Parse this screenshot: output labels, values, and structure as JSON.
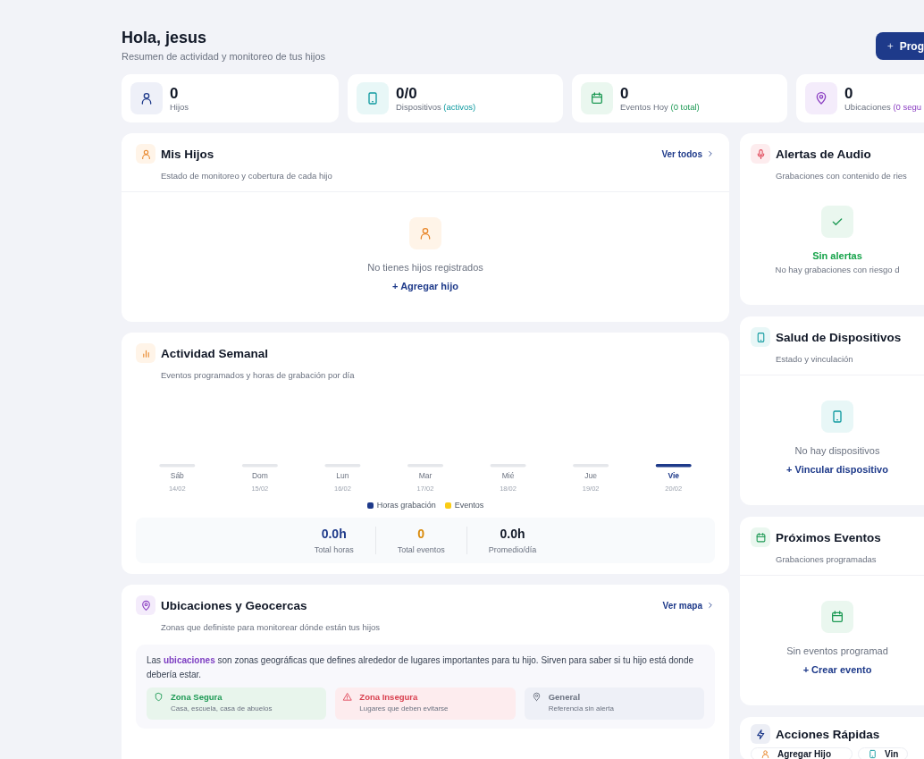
{
  "header": {
    "title": "Hola, jesus",
    "subtitle": "Resumen de actividad y monitoreo de tus hijos",
    "action_button": "Prog"
  },
  "stats": [
    {
      "kind": "children",
      "value": "0",
      "label": "Hijos"
    },
    {
      "kind": "devices",
      "value": "0/0",
      "label": "Dispositivos",
      "note": "(activos)"
    },
    {
      "kind": "events",
      "value": "0",
      "label": "Eventos Hoy",
      "note": "(0 total)"
    },
    {
      "kind": "locations",
      "value": "0",
      "label": "Ubicaciones",
      "note": "(0 segu"
    }
  ],
  "children_card": {
    "title": "Mis Hijos",
    "subtitle": "Estado de monitoreo y cobertura de cada hijo",
    "link": "Ver todos",
    "empty_message": "No tienes hijos registrados",
    "empty_action": "+ Agregar hijo"
  },
  "activity_card": {
    "title": "Actividad Semanal",
    "subtitle": "Eventos programados y horas de grabación por día",
    "days": [
      {
        "label": "Sáb",
        "date": "14/02",
        "selected": false
      },
      {
        "label": "Dom",
        "date": "15/02",
        "selected": false
      },
      {
        "label": "Lun",
        "date": "16/02",
        "selected": false
      },
      {
        "label": "Mar",
        "date": "17/02",
        "selected": false
      },
      {
        "label": "Mié",
        "date": "18/02",
        "selected": false
      },
      {
        "label": "Jue",
        "date": "19/02",
        "selected": false
      },
      {
        "label": "Vie",
        "date": "20/02",
        "selected": true
      }
    ],
    "legend": [
      {
        "label": "Horas grabación",
        "color": "#1e3a8a"
      },
      {
        "label": "Eventos",
        "color": "#facc15"
      }
    ],
    "totals": [
      {
        "value": "0.0h",
        "label": "Total horas",
        "color": "#1e3a8a"
      },
      {
        "value": "0",
        "label": "Total eventos",
        "color": "#d98a0b"
      },
      {
        "value": "0.0h",
        "label": "Promedio/día",
        "color": "#111827"
      }
    ]
  },
  "locations_card": {
    "title": "Ubicaciones y Geocercas",
    "subtitle": "Zonas que definiste para monitorear dónde están tus hijos",
    "link": "Ver mapa",
    "info": "Las **ubicaciones** son zonas geográficas que defines alrededor de lugares importantes para tu hijo. Sirven para saber si tu hijo está donde debería estar.",
    "zones": [
      {
        "kind": "safe",
        "title": "Zona Segura",
        "description": "Casa, escuela, casa de abuelos"
      },
      {
        "kind": "unsafe",
        "title": "Zona Insegura",
        "description": "Lugares que deben evitarse"
      },
      {
        "kind": "general",
        "title": "General",
        "description": "Referencia sin alerta"
      }
    ]
  },
  "sidebar": [
    {
      "kind": "audio",
      "title": "Alertas de Audio",
      "subtitle": "Grabaciones con contenido de ries",
      "empty_status": "Sin alertas",
      "empty_message": "No hay grabaciones con riesgo d"
    },
    {
      "kind": "devices",
      "title": "Salud de Dispositivos",
      "subtitle": "Estado y vinculación",
      "empty_message": "No hay dispositivos",
      "empty_action": "+ Vincular dispositivo"
    },
    {
      "kind": "events",
      "title": "Próximos Eventos",
      "subtitle": "Grabaciones programadas",
      "empty_message": "Sin eventos programad",
      "empty_action": "+ Crear evento"
    },
    {
      "kind": "actions",
      "title": "Acciones Rápidas",
      "actions": [
        {
          "kind": "child",
          "label": "Agregar Hijo"
        },
        {
          "kind": "device",
          "label": "Vin"
        }
      ]
    }
  ]
}
